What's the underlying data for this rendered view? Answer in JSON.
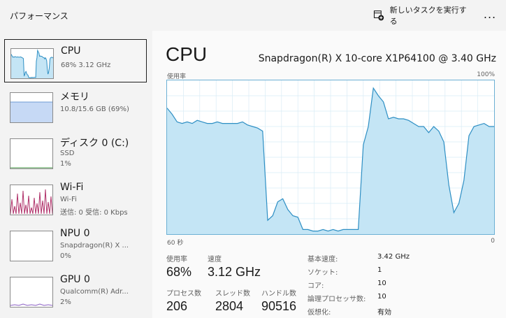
{
  "header": {
    "title": "パフォーマンス",
    "new_task_label": "新しいタスクを実行する",
    "more_label": "..."
  },
  "sidebar": {
    "items": [
      {
        "name": "CPU",
        "lines": [
          "68%  3.12 GHz"
        ],
        "selected": true
      },
      {
        "name": "メモリ",
        "lines": [
          "10.8/15.6 GB (69%)"
        ]
      },
      {
        "name": "ディスク 0 (C:)",
        "lines": [
          "SSD",
          "1%"
        ]
      },
      {
        "name": "Wi-Fi",
        "lines": [
          "Wi-Fi",
          "送信: 0 受信: 0 Kbps"
        ]
      },
      {
        "name": "NPU 0",
        "lines": [
          "Snapdragon(R) X ...",
          "0%"
        ]
      },
      {
        "name": "GPU 0",
        "lines": [
          "Qualcomm(R) Adr...",
          "2%"
        ]
      }
    ]
  },
  "main": {
    "title": "CPU",
    "model": "Snapdragon(R) X 10-core X1P64100 @ 3.40 GHz",
    "util_label": "使用率",
    "max_label": "100%",
    "time_left": "60 秒",
    "time_right": "0",
    "stats": {
      "utilization": {
        "label": "使用率",
        "value": "68%"
      },
      "speed": {
        "label": "速度",
        "value": "3.12 GHz"
      },
      "processes": {
        "label": "プロセス数",
        "value": "206"
      },
      "threads": {
        "label": "スレッド数",
        "value": "2804"
      },
      "handles": {
        "label": "ハンドル数",
        "value": "90516"
      }
    },
    "specs": [
      {
        "key": "基本速度:",
        "value": "3.42 GHz"
      },
      {
        "key": "ソケット:",
        "value": "1"
      },
      {
        "key": "コア:",
        "value": "10"
      },
      {
        "key": "論理プロセッサ数:",
        "value": "10"
      },
      {
        "key": "仮想化:",
        "value": "有効"
      }
    ]
  },
  "colors": {
    "cpu_line": "#2e8fc4",
    "cpu_fill": "#c4e5f5",
    "grid": "#d9ecf6",
    "memory_fill": "#c6d9f5",
    "memory_line": "#6e9ad3",
    "wifi_line": "#b0326a",
    "gpu_line": "#8a5fc4"
  },
  "chart_data": {
    "type": "area",
    "x": [
      60,
      59,
      58,
      57,
      56,
      55,
      54,
      53,
      52,
      51,
      50,
      49,
      48,
      47,
      46,
      45,
      44,
      43,
      42,
      41,
      40,
      39,
      38,
      37,
      36,
      35,
      34,
      33,
      32,
      31,
      30,
      29,
      28,
      27,
      26,
      25,
      24,
      23,
      22,
      21,
      20,
      19,
      18,
      17,
      16,
      15,
      14,
      13,
      12,
      11,
      10,
      9,
      8,
      7,
      6,
      5,
      4,
      3,
      2,
      1,
      0
    ],
    "values": [
      82,
      78,
      73,
      72,
      73,
      72,
      74,
      73,
      72,
      72,
      73,
      72,
      72,
      72,
      72,
      73,
      71,
      70,
      69,
      67,
      9,
      12,
      21,
      23,
      16,
      12,
      11,
      3,
      3,
      2,
      2,
      3,
      2,
      3,
      2,
      3,
      3,
      3,
      3,
      58,
      70,
      95,
      90,
      86,
      75,
      76,
      75,
      75,
      74,
      72,
      70,
      70,
      66,
      70,
      67,
      60,
      32,
      14,
      20,
      35,
      64,
      70,
      71,
      72,
      70,
      70
    ],
    "ylim": [
      0,
      100
    ]
  }
}
